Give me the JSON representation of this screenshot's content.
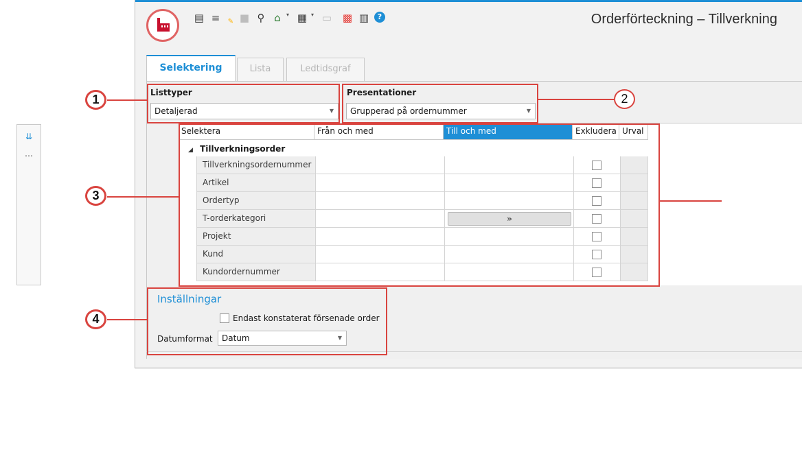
{
  "window": {
    "title": "Orderförteckning – Tillverkning",
    "accent": "#1e8fd6",
    "logo_color": "#c8102e"
  },
  "toolbar": {
    "icons": [
      "list-icon",
      "edit-list-icon",
      "save-icon",
      "search-icon",
      "home-icon",
      "calculator-icon",
      "window-icon",
      "color-grid-icon",
      "report-icon",
      "help-icon"
    ]
  },
  "tabs": [
    {
      "label": "Selektering",
      "active": true
    },
    {
      "label": "Lista",
      "active": false
    },
    {
      "label": "Ledtidsgraf",
      "active": false
    }
  ],
  "listtyper": {
    "label": "Listtyper",
    "value": "Detaljerad"
  },
  "presentationer": {
    "label": "Presentationer",
    "value": "Grupperad på ordernummer"
  },
  "grid": {
    "columns": {
      "select": "Selektera",
      "from": "Från och med",
      "to": "Till och med",
      "exclude": "Exkludera",
      "urval": "Urval"
    },
    "group": "Tillverkningsorder",
    "group_glyph": "◢",
    "rows": [
      {
        "label": "Tillverkningsordernummer"
      },
      {
        "label": "Artikel"
      },
      {
        "label": "Ordertyp"
      },
      {
        "label": "T-orderkategori",
        "button": "»"
      },
      {
        "label": "Projekt"
      },
      {
        "label": "Kund"
      },
      {
        "label": "Kundordernummer"
      }
    ]
  },
  "settings": {
    "title": "Inställningar",
    "checkbox_label": "Endast konstaterat försenade order",
    "date_label": "Datumformat",
    "date_value": "Datum"
  },
  "callouts": {
    "one": "1",
    "two": "2",
    "three": "3",
    "four": "4"
  }
}
